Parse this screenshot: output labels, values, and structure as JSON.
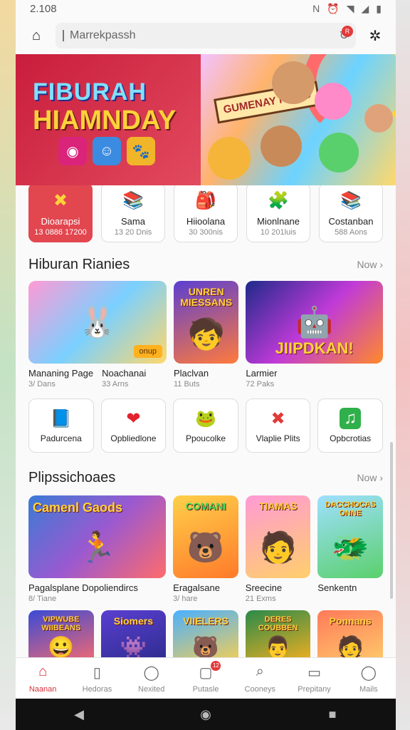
{
  "status": {
    "time": "2.108",
    "icons": [
      "nfc-icon",
      "alarm-icon",
      "wifi-icon",
      "signal-icon",
      "battery-icon"
    ]
  },
  "search": {
    "placeholder": "Marrekpassh"
  },
  "hero": {
    "title_line1": "FIBURAH",
    "title_line2": "HIAMNDAY",
    "sign_text": "GUMENAY NOMD"
  },
  "categories": [
    {
      "icon": "✖",
      "name": "Dioarapsi",
      "count": "13 0886 17200",
      "active": true
    },
    {
      "icon": "📚",
      "name": "Sama",
      "count": "13 20 Dnis"
    },
    {
      "icon": "🎒",
      "name": "Hiioolana",
      "count": "30 300nis"
    },
    {
      "icon": "🧩",
      "name": "Mionlnane",
      "count": "10 201luis"
    },
    {
      "icon": "📚",
      "name": "Costanban",
      "count": "588 Aons"
    }
  ],
  "section1": {
    "title": "Hiburan Rianies",
    "more": "Now ›",
    "cards": [
      {
        "title": "Mananing Page",
        "sub": "3/ Dans",
        "tag": "onup",
        "emoji": "🐰"
      },
      {
        "title": "Noachanai",
        "sub": "33 Arns",
        "emoji": "🎮"
      },
      {
        "title": "Placlvan",
        "sub": "11 Buts",
        "cover": "UNREN MIESSANS",
        "emoji": "🧒"
      },
      {
        "title": "Larmier",
        "sub": "72 Paks",
        "cover": "JIIPDKAN!",
        "emoji": "🤖"
      }
    ]
  },
  "apps": [
    {
      "icon": "📘",
      "name": "Padurcena"
    },
    {
      "icon": "❤",
      "name": "Opbliedlone"
    },
    {
      "icon": "🐸",
      "name": "Ppoucolke"
    },
    {
      "icon": "✖",
      "name": "Vlaplie Plits"
    },
    {
      "icon": "♫",
      "name": "Opbcrotias"
    }
  ],
  "section2": {
    "title": "Plipssichoaes",
    "more": "Now ›",
    "cards": [
      {
        "title": "Pagalsplane Dopoliendircs",
        "sub": "8/ Tiane",
        "cover": "Camenl Gaods",
        "emoji": "🏃"
      },
      {
        "title": "Eragalsane",
        "sub": "3/ hare",
        "cover": "COMANI",
        "emoji": "🐻"
      },
      {
        "title": "Sreecine",
        "sub": "21 Exms",
        "cover": "TIAMAS",
        "emoji": "🧑"
      },
      {
        "title": "Senkentn",
        "sub": "",
        "cover": "DACCHOCAS ONNE",
        "emoji": "🐲"
      }
    ],
    "row2": [
      {
        "cover": "VIPWUBE WIIBEANS",
        "emoji": "😀"
      },
      {
        "cover": "Siomers",
        "emoji": "👾"
      },
      {
        "cover": "VIIELERS",
        "emoji": "🐻"
      },
      {
        "cover": "DERES COUBBEN",
        "emoji": "👨"
      },
      {
        "cover": "Ponnans",
        "emoji": "🧑"
      }
    ]
  },
  "nav": [
    {
      "label": "Naanan",
      "icon": "⌂",
      "active": true
    },
    {
      "label": "Hedoras",
      "icon": "▯"
    },
    {
      "label": "Nexited",
      "icon": "◯"
    },
    {
      "label": "Putasle",
      "icon": "▢",
      "badge": "12"
    },
    {
      "label": "Cooneys",
      "icon": "⌕"
    },
    {
      "label": "Prepitany",
      "icon": "▭"
    },
    {
      "label": "Mails",
      "icon": "◯"
    }
  ],
  "colors": {
    "accent": "#d7323c",
    "hero_left": "#c91d3c"
  }
}
